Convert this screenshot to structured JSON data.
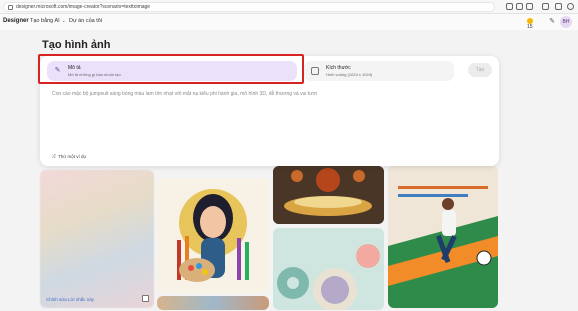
{
  "browser": {
    "url": "designer.microsoft.com/image-creator?scenario=texttoimage"
  },
  "header": {
    "logo": "Designer",
    "nav": [
      "Tạo bằng AI",
      "Dự án của tôi"
    ],
    "coins": "15",
    "avatar": "BH"
  },
  "page": {
    "title": "Tạo hình ảnh"
  },
  "composer": {
    "style_label": "Mô tả",
    "style_sub": "Mô tả những gì bạn muốn tạo",
    "size_label": "Kích thước",
    "size_value": "Hình vuông (1024 x 1024)",
    "generate": "Tạo",
    "prompt_placeholder": "Con cáo mặc bộ jumpsuit sáng bóng màu lam tím nhạt với mặt nạ kiểu phi hành gia, mô hình 3D, dễ thương và vui tươi",
    "try_example": "Thử một ví dụ"
  },
  "gallery": {
    "edit_prompt": "Chỉnh sửa Lời nhắc này"
  },
  "colors": {
    "highlight": "#d82323",
    "style_pill": "#ebe1fb",
    "coin": "#f5b700"
  }
}
